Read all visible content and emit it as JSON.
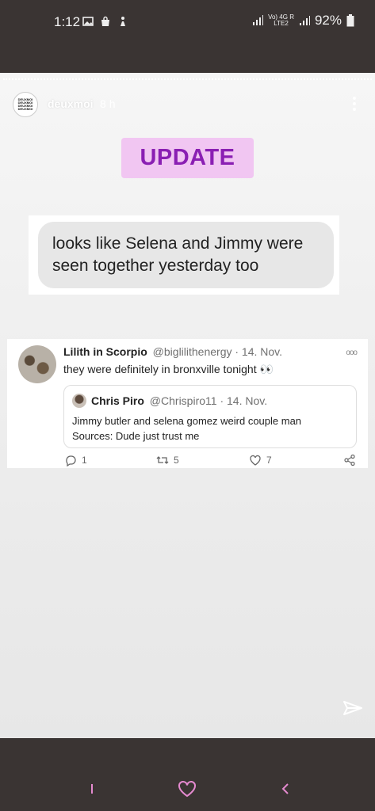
{
  "status_bar": {
    "time": "1:12",
    "network_top": "Vo) 4G R",
    "network_bottom": "LTE2",
    "battery": "92%"
  },
  "story": {
    "account_name": "deuxmoi",
    "age": "8 h",
    "avatar_logo": "DEUXMOI",
    "badge": "UPDATE",
    "caption": "looks like Selena and Jimmy were seen together yesterday too"
  },
  "tweet": {
    "name": "Lilith in Scorpio",
    "handle": "@biglilithenergy · 14. Nov.",
    "text": "they were definitely in bronxville tonight 👀",
    "quote": {
      "name": "Chris Piro",
      "handle": "@Chrispiro11 · 14. Nov.",
      "line1": "Jimmy butler and selena gomez weird couple man",
      "line2": "Sources: Dude just trust me"
    },
    "replies": "1",
    "retweets": "5",
    "likes": "7"
  },
  "colors": {
    "badge_bg": "#f1c6f2",
    "badge_text": "#8a1fb3",
    "nav_heart": "#e58ad0",
    "system_bar": "#3a3433"
  }
}
